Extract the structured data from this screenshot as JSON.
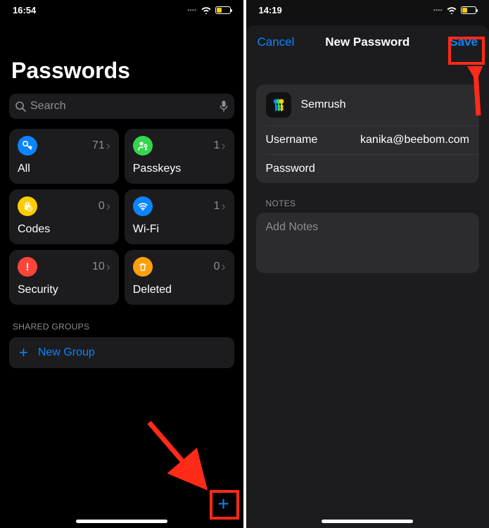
{
  "left": {
    "status_time": "16:54",
    "title": "Passwords",
    "search_placeholder": "Search",
    "tiles": [
      {
        "label": "All",
        "count": "71"
      },
      {
        "label": "Passkeys",
        "count": "1"
      },
      {
        "label": "Codes",
        "count": "0"
      },
      {
        "label": "Wi-Fi",
        "count": "1"
      },
      {
        "label": "Security",
        "count": "10"
      },
      {
        "label": "Deleted",
        "count": "0"
      }
    ],
    "shared_groups_header": "SHARED GROUPS",
    "new_group_label": "New Group"
  },
  "right": {
    "status_time": "14:19",
    "cancel": "Cancel",
    "title": "New Password",
    "save": "Save",
    "site": "Semrush",
    "username_label": "Username",
    "username_value": "kanika@beebom.com",
    "password_label": "Password",
    "notes_header": "NOTES",
    "notes_placeholder": "Add Notes"
  }
}
